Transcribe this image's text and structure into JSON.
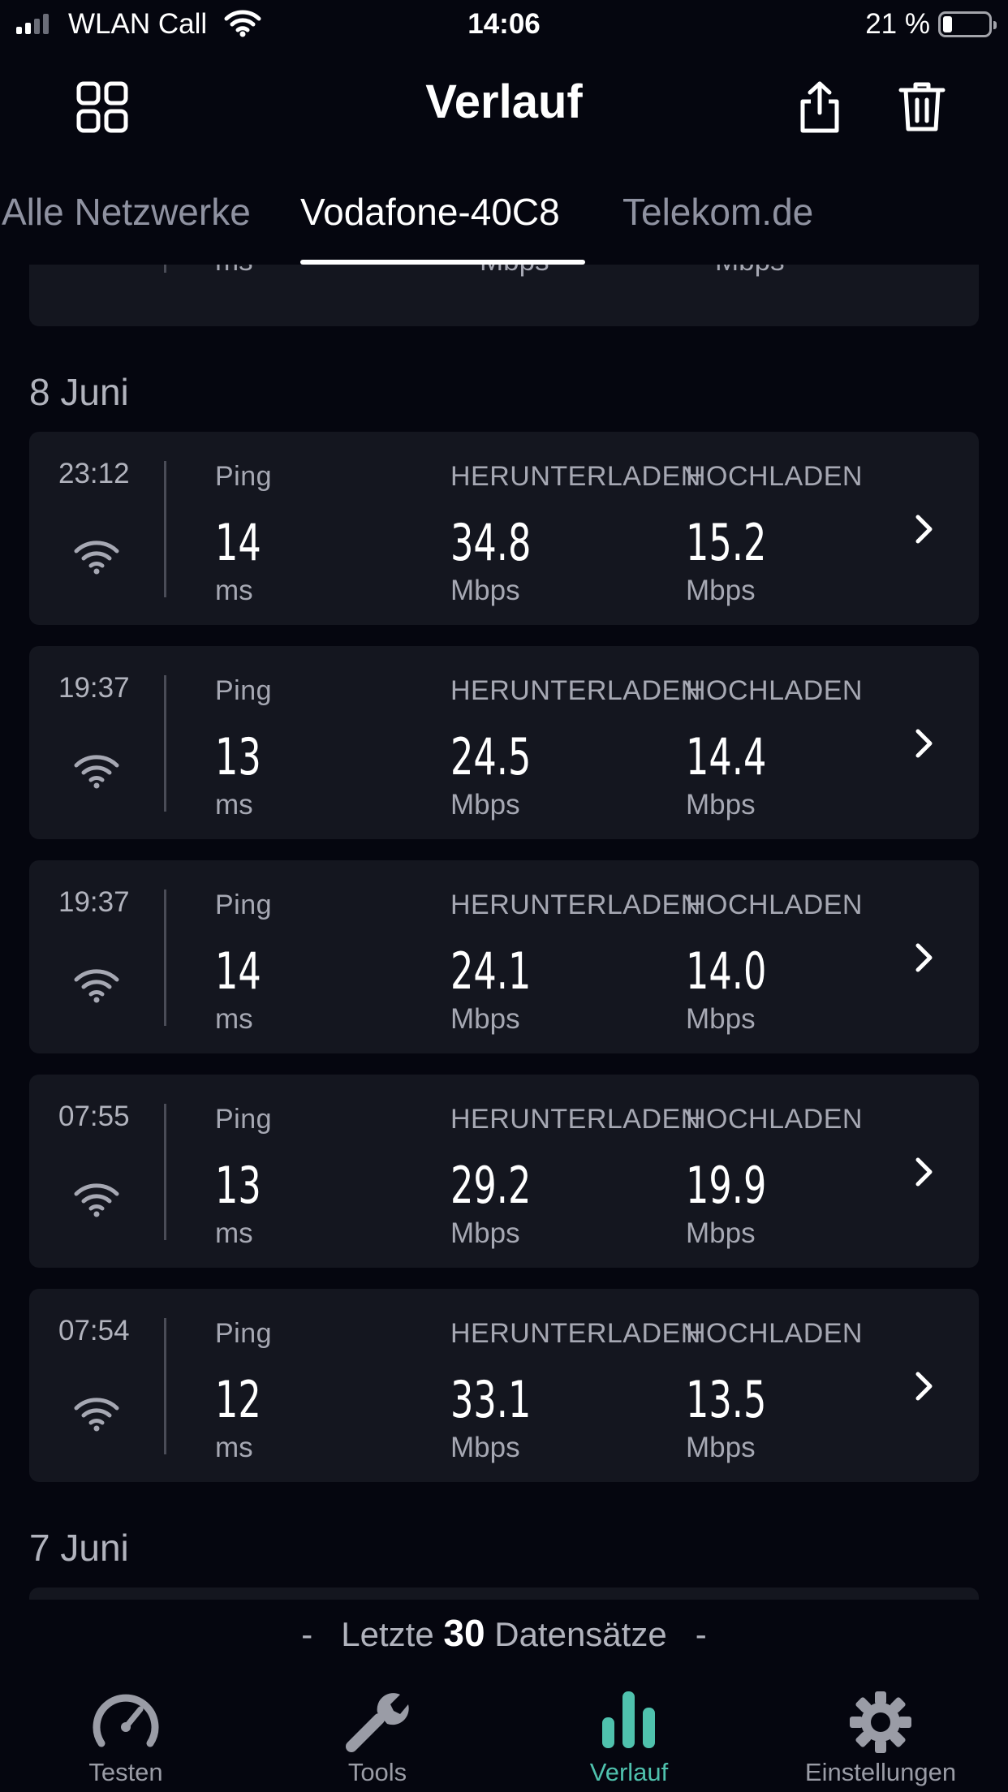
{
  "status_bar": {
    "carrier": "WLAN Call",
    "time": "14:06",
    "battery": "21 %"
  },
  "header": {
    "title": "Verlauf",
    "left_icon": "grid-icon",
    "right_icons": [
      "share-icon",
      "trash-icon"
    ]
  },
  "tabs": [
    {
      "label": "Alle Netzwerke",
      "active": false
    },
    {
      "label": "Vodafone-40C8",
      "active": true
    },
    {
      "label": "Telekom.de",
      "active": false
    }
  ],
  "partial_row": {
    "ping_unit": "ms",
    "down_unit": "Mbps",
    "up_unit": "Mbps"
  },
  "sections": [
    {
      "date": "8 Juni",
      "rows": [
        {
          "time": "23:12",
          "ping_label": "Ping",
          "ping": "14",
          "ping_unit": "ms",
          "down_label": "HERUNTERLADEN",
          "down": "34.8",
          "down_unit": "Mbps",
          "up_label": "HOCHLADEN",
          "up": "15.2",
          "up_unit": "Mbps"
        },
        {
          "time": "19:37",
          "ping_label": "Ping",
          "ping": "13",
          "ping_unit": "ms",
          "down_label": "HERUNTERLADEN",
          "down": "24.5",
          "down_unit": "Mbps",
          "up_label": "HOCHLADEN",
          "up": "14.4",
          "up_unit": "Mbps"
        },
        {
          "time": "19:37",
          "ping_label": "Ping",
          "ping": "14",
          "ping_unit": "ms",
          "down_label": "HERUNTERLADEN",
          "down": "24.1",
          "down_unit": "Mbps",
          "up_label": "HOCHLADEN",
          "up": "14.0",
          "up_unit": "Mbps"
        },
        {
          "time": "07:55",
          "ping_label": "Ping",
          "ping": "13",
          "ping_unit": "ms",
          "down_label": "HERUNTERLADEN",
          "down": "29.2",
          "down_unit": "Mbps",
          "up_label": "HOCHLADEN",
          "up": "19.9",
          "up_unit": "Mbps"
        },
        {
          "time": "07:54",
          "ping_label": "Ping",
          "ping": "12",
          "ping_unit": "ms",
          "down_label": "HERUNTERLADEN",
          "down": "33.1",
          "down_unit": "Mbps",
          "up_label": "HOCHLADEN",
          "up": "13.5",
          "up_unit": "Mbps"
        }
      ]
    },
    {
      "date": "7 Juni",
      "rows": []
    }
  ],
  "footer": {
    "dash": "-",
    "prefix": "Letzte",
    "count": "30",
    "suffix": "Datensätze"
  },
  "bottom_nav": [
    {
      "label": "Testen",
      "icon": "speedometer-icon",
      "active": false
    },
    {
      "label": "Tools",
      "icon": "wrench-icon",
      "active": false
    },
    {
      "label": "Verlauf",
      "icon": "bar-chart-icon",
      "active": true
    },
    {
      "label": "Einstellungen",
      "icon": "gear-icon",
      "active": false
    }
  ],
  "colors": {
    "background": "#05060f",
    "card": "#14161f",
    "accent": "#4fc1ad",
    "muted_text": "#a6a8b3"
  }
}
